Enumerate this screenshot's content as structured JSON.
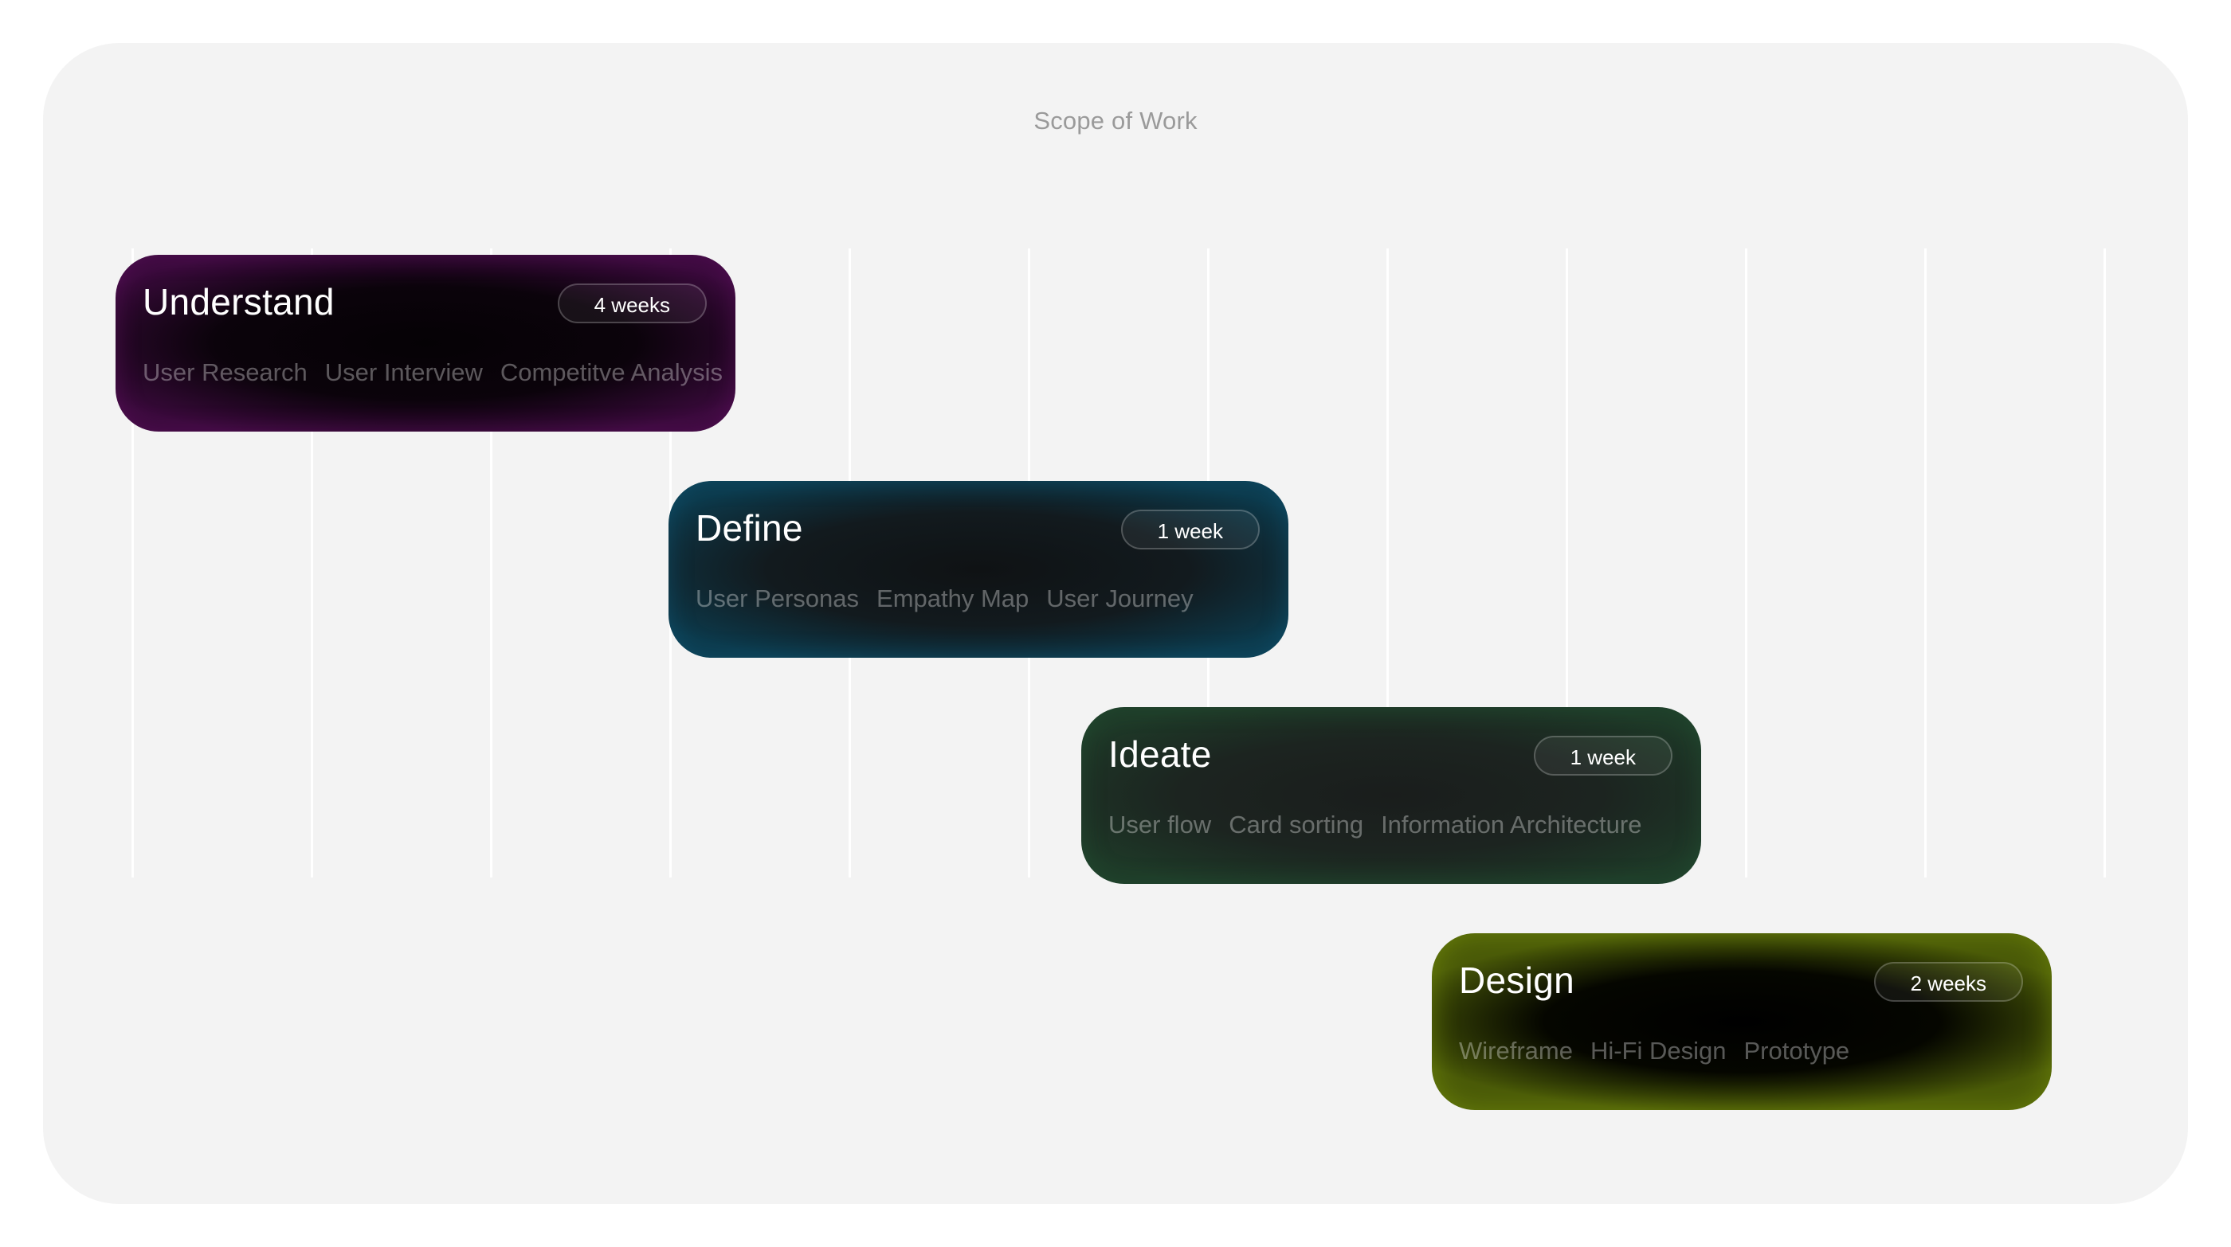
{
  "title": "Scope of Work",
  "phases": [
    {
      "name": "Understand",
      "duration": "4 weeks",
      "tags": [
        "User Research",
        "User Interview",
        "Competitve Analysis"
      ],
      "accent": "#3a0a3c"
    },
    {
      "name": "Define",
      "duration": "1 week",
      "tags": [
        "User Personas",
        "Empathy Map",
        "User Journey"
      ],
      "accent": "#0c3a4c"
    },
    {
      "name": "Ideate",
      "duration": "1 week",
      "tags": [
        "User flow",
        "Card sorting",
        "Information Architecture"
      ],
      "accent": "#1e3a28"
    },
    {
      "name": "Design",
      "duration": "2 weeks",
      "tags": [
        "Wireframe",
        "Hi-Fi Design",
        "Prototype"
      ],
      "accent": "#4a5a08"
    }
  ],
  "colors": {
    "background": "#f3f3f3",
    "title_text": "#9a9a9a"
  }
}
